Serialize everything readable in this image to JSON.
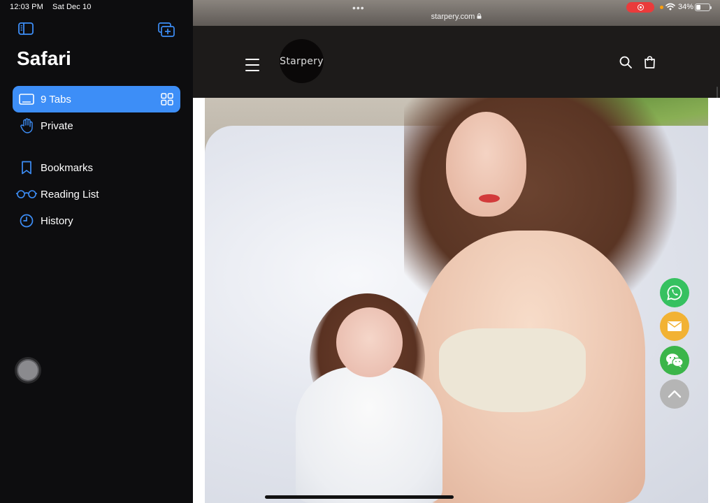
{
  "status_bar": {
    "time": "12:03 PM",
    "date": "Sat Dec 10",
    "battery_text": "34%",
    "battery_level": 0.34
  },
  "sidebar": {
    "title": "Safari",
    "items": [
      {
        "label": "9 Tabs",
        "icon": "tabs-icon",
        "active": true
      },
      {
        "label": "Private",
        "icon": "hand-icon"
      },
      {
        "label": "Bookmarks",
        "icon": "bookmark-icon"
      },
      {
        "label": "Reading List",
        "icon": "glasses-icon"
      },
      {
        "label": "History",
        "icon": "clock-icon"
      }
    ]
  },
  "browser": {
    "url": "starpery.com",
    "more_dots": "•••"
  },
  "site": {
    "logo_text": "Starpery",
    "icons": [
      "menu-icon",
      "search-icon",
      "cart-icon"
    ]
  },
  "floating_buttons": [
    "whatsapp-icon",
    "email-icon",
    "wechat-icon",
    "scroll-top-icon"
  ],
  "colors": {
    "accent": "#3d8ef7",
    "header_bg": "#1d1b1a",
    "whatsapp": "#36c160",
    "email": "#f2b233",
    "wechat": "#3bb54a",
    "recording": "#ea3b3b"
  }
}
